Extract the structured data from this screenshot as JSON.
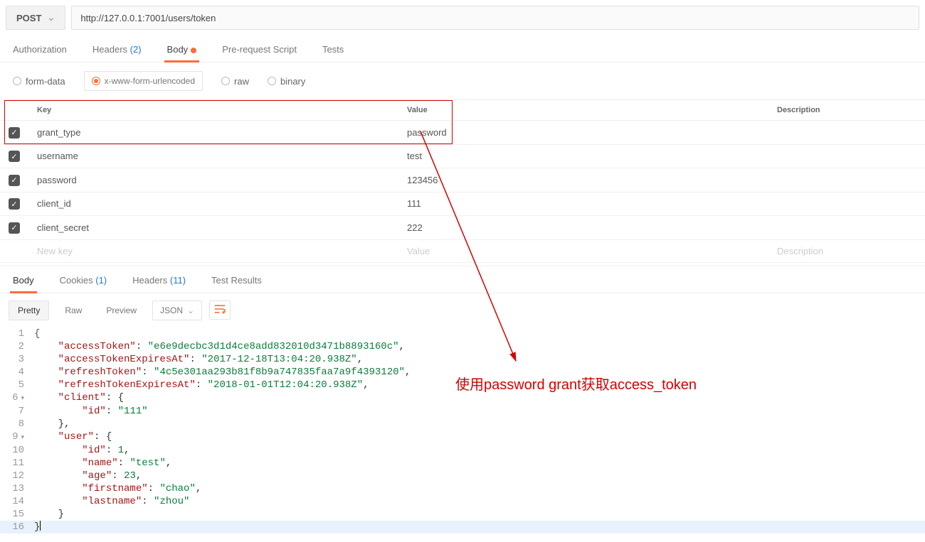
{
  "request": {
    "method": "POST",
    "url": "http://127.0.0.1:7001/users/token"
  },
  "req_tabs": {
    "authorization": "Authorization",
    "headers": "Headers",
    "headers_count": "(2)",
    "body": "Body",
    "pre": "Pre-request Script",
    "tests": "Tests"
  },
  "body_types": {
    "form_data": "form-data",
    "urlencoded": "x-www-form-urlencoded",
    "raw": "raw",
    "binary": "binary"
  },
  "param_headers": {
    "key": "Key",
    "value": "Value",
    "desc": "Description"
  },
  "params": [
    {
      "checked": true,
      "key": "grant_type",
      "value": "password"
    },
    {
      "checked": true,
      "key": "username",
      "value": "test"
    },
    {
      "checked": true,
      "key": "password",
      "value": "123456"
    },
    {
      "checked": true,
      "key": "client_id",
      "value": "111"
    },
    {
      "checked": true,
      "key": "client_secret",
      "value": "222"
    }
  ],
  "param_placeholder": {
    "key": "New key",
    "value": "Value",
    "desc": "Description"
  },
  "resp_tabs": {
    "body": "Body",
    "cookies": "Cookies",
    "cookies_count": "(1)",
    "headers": "Headers",
    "headers_count": "(11)",
    "tests": "Test Results"
  },
  "view": {
    "pretty": "Pretty",
    "raw": "Raw",
    "preview": "Preview",
    "format": "JSON"
  },
  "response_json": {
    "accessToken": "e6e9decbc3d1d4ce8add832010d3471b8893160c",
    "accessTokenExpiresAt": "2017-12-18T13:04:20.938Z",
    "refreshToken": "4c5e301aa293b81f8b9a747835faa7a9f4393120",
    "refreshTokenExpiresAt": "2018-01-01T12:04:20.938Z",
    "client": {
      "id": "111"
    },
    "user": {
      "id": 1,
      "name": "test",
      "age": 23,
      "firstname": "chao",
      "lastname": "zhou"
    }
  },
  "annotation": "使用password grant获取access_token"
}
